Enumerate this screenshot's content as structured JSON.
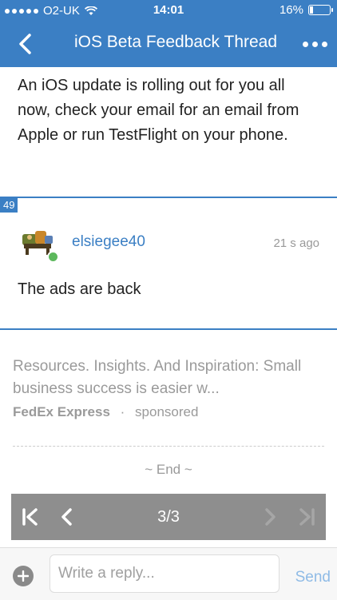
{
  "status_bar": {
    "carrier": "O2-UK",
    "time": "14:01",
    "battery": "16%",
    "battery_level": 0.16
  },
  "nav": {
    "title": "iOS Beta Feedback Thread"
  },
  "previous_post": {
    "body": "An iOS update is rolling out for you all now, check your email for an email from Apple or run TestFlight on your phone."
  },
  "post": {
    "number": "49",
    "username": "elsiegee40",
    "time": "21 s ago",
    "body": "The ads are back"
  },
  "ad": {
    "headline": "Resources. Insights. And Inspiration: Small business success is easier w...",
    "advertiser": "FedEx Express",
    "separator": "·",
    "label": "sponsored"
  },
  "end_label": "~ End ~",
  "pager": {
    "label": "3/3"
  },
  "composer": {
    "placeholder": "Write a reply...",
    "send_label": "Send"
  },
  "colors": {
    "accent": "#3b7fc4",
    "online": "#5cb85c",
    "muted": "#9a9a9a",
    "pager_bg": "#8e8e8e"
  }
}
